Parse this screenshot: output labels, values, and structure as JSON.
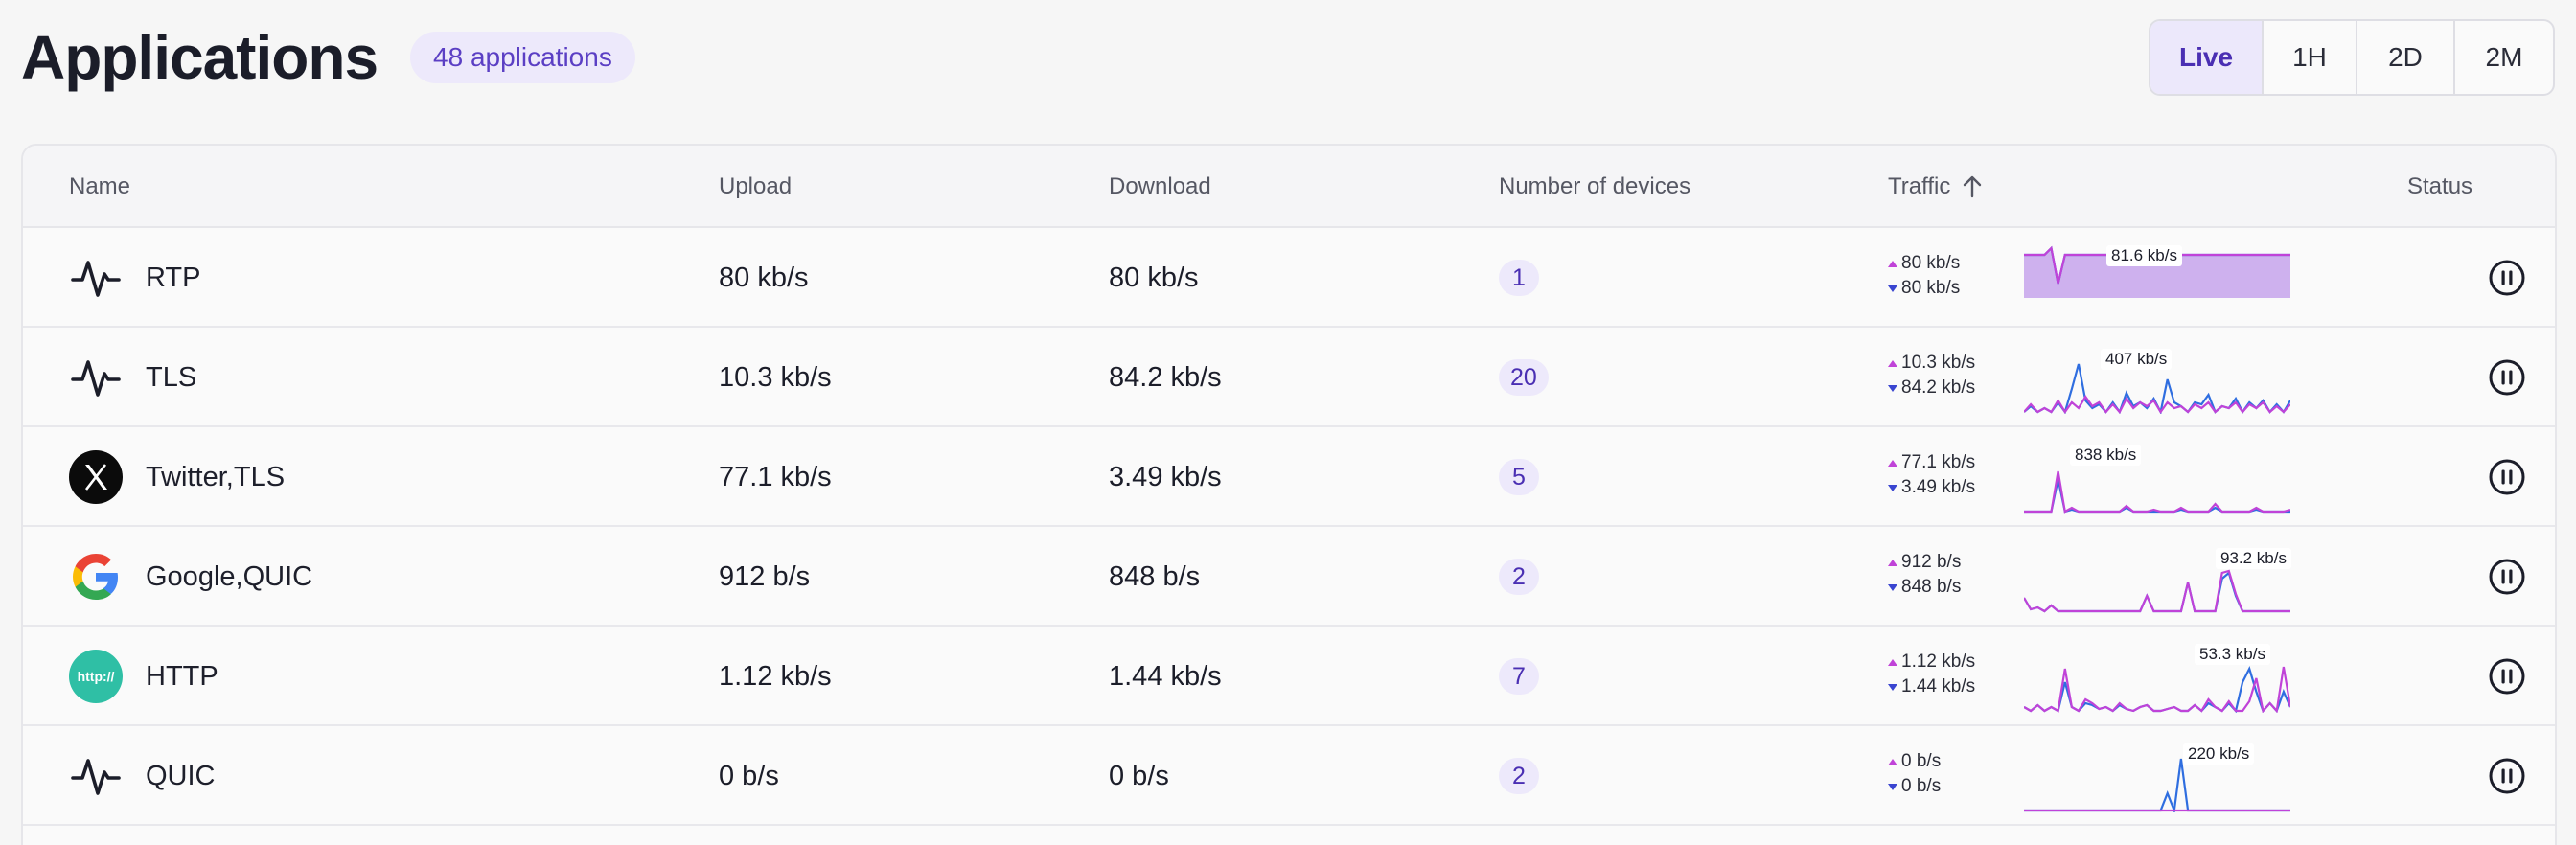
{
  "header": {
    "title": "Applications",
    "count_badge": "48 applications"
  },
  "time_ranges": [
    {
      "label": "Live",
      "active": true
    },
    {
      "label": "1H",
      "active": false
    },
    {
      "label": "2D",
      "active": false
    },
    {
      "label": "2M",
      "active": false
    }
  ],
  "table": {
    "columns": {
      "name": "Name",
      "upload": "Upload",
      "download": "Download",
      "devices": "Number of devices",
      "traffic": "Traffic",
      "status": "Status"
    },
    "traffic_sort": "ascending",
    "rows": [
      {
        "name": "RTP",
        "icon": "activity-icon",
        "upload": "80 kb/s",
        "download": "80 kb/s",
        "devices": "1",
        "traffic_up": "80 kb/s",
        "traffic_down": "80 kb/s",
        "peak_label": "81.6 kb/s",
        "status_icon": "pause-circle-icon"
      },
      {
        "name": "TLS",
        "icon": "activity-icon",
        "upload": "10.3 kb/s",
        "download": "84.2 kb/s",
        "devices": "20",
        "traffic_up": "10.3 kb/s",
        "traffic_down": "84.2 kb/s",
        "peak_label": "407 kb/s",
        "status_icon": "pause-circle-icon"
      },
      {
        "name": "Twitter,TLS",
        "icon": "x-logo-icon",
        "upload": "77.1 kb/s",
        "download": "3.49 kb/s",
        "devices": "5",
        "traffic_up": "77.1 kb/s",
        "traffic_down": "3.49 kb/s",
        "peak_label": "838 kb/s",
        "status_icon": "pause-circle-icon"
      },
      {
        "name": "Google,QUIC",
        "icon": "google-logo-icon",
        "upload": "912 b/s",
        "download": "848 b/s",
        "devices": "2",
        "traffic_up": "912 b/s",
        "traffic_down": "848 b/s",
        "peak_label": "93.2 kb/s",
        "status_icon": "pause-circle-icon"
      },
      {
        "name": "HTTP",
        "icon": "http-icon",
        "icon_text": "http://",
        "upload": "1.12 kb/s",
        "download": "1.44 kb/s",
        "devices": "7",
        "traffic_up": "1.12 kb/s",
        "traffic_down": "1.44 kb/s",
        "peak_label": "53.3 kb/s",
        "status_icon": "pause-circle-icon"
      },
      {
        "name": "QUIC",
        "icon": "activity-icon",
        "upload": "0 b/s",
        "download": "0 b/s",
        "devices": "2",
        "traffic_up": "0 b/s",
        "traffic_down": "0 b/s",
        "peak_label": "220 kb/s",
        "status_icon": "pause-circle-icon"
      }
    ]
  },
  "colors": {
    "upload_series": "#c043d8",
    "download_series": "#2f6ee0",
    "badge_bg": "#ede9fb",
    "badge_text": "#4a2fb3",
    "http_icon_bg": "#2fbfa5"
  }
}
